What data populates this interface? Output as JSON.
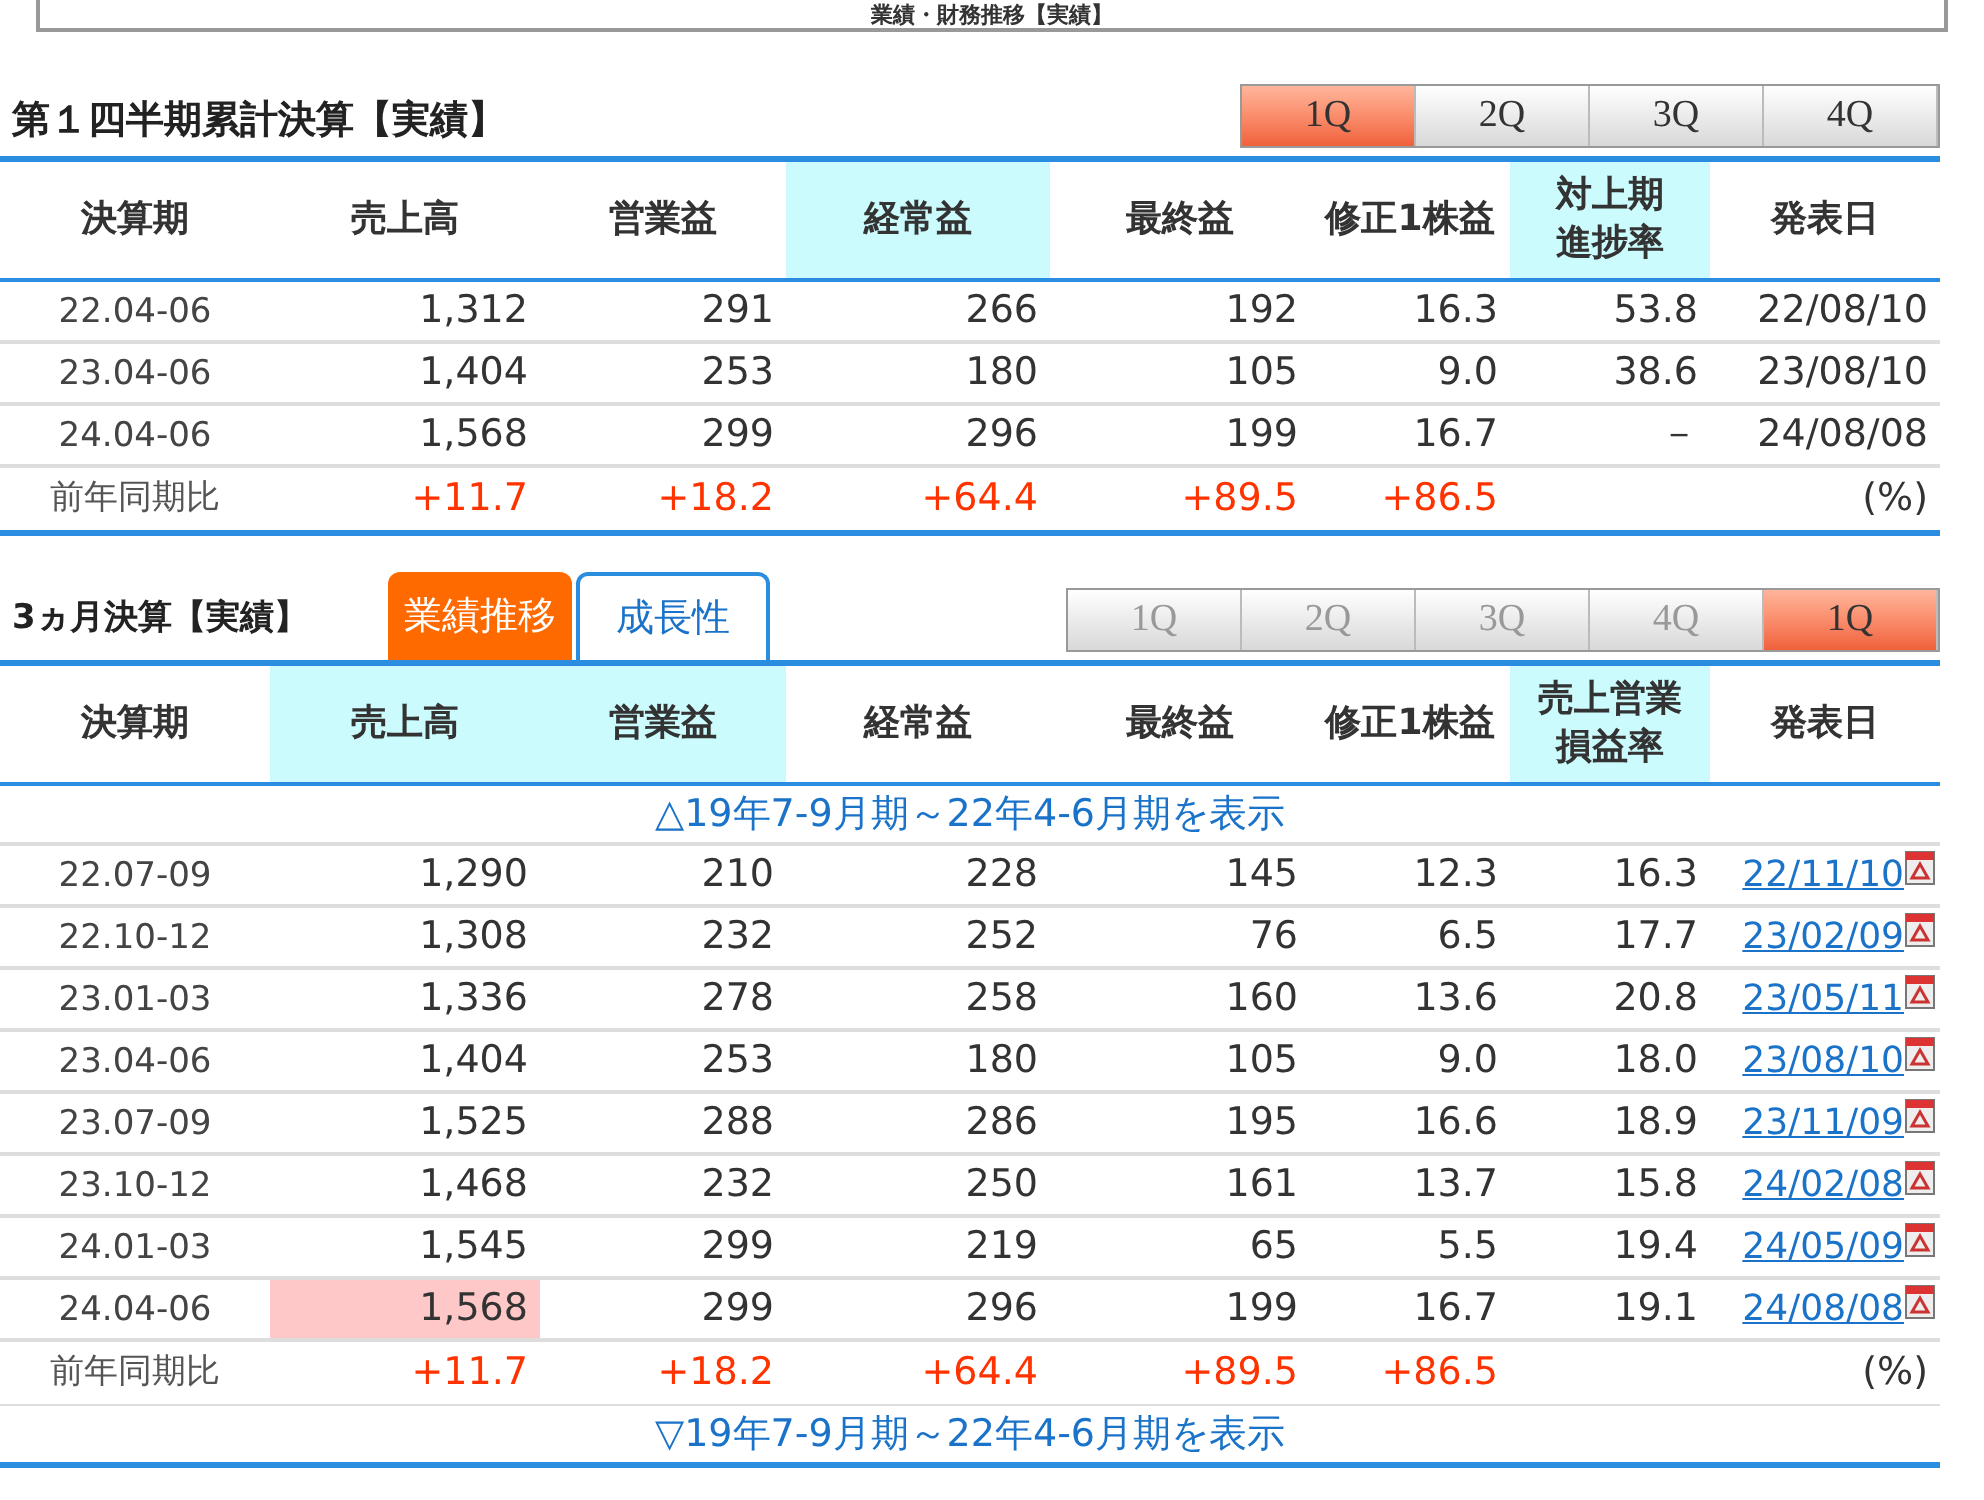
{
  "top_panel": {
    "title": "業績・財務推移【実績】"
  },
  "sections": [
    {
      "title": "第１四半期累計決算【実績】",
      "quarter_buttons": [
        {
          "label": "1Q",
          "selected": true,
          "disabled": false
        },
        {
          "label": "2Q",
          "selected": false,
          "disabled": false
        },
        {
          "label": "3Q",
          "selected": false,
          "disabled": false
        },
        {
          "label": "4Q",
          "selected": false,
          "disabled": false
        }
      ],
      "columns": [
        {
          "label": "決算期",
          "highlighted": false,
          "kind": "text"
        },
        {
          "label": "売上高",
          "highlighted": false,
          "kind": "number"
        },
        {
          "label": "営業益",
          "highlighted": false,
          "kind": "number"
        },
        {
          "label": "経常益",
          "highlighted": true,
          "kind": "number"
        },
        {
          "label": "最終益",
          "highlighted": false,
          "kind": "number"
        },
        {
          "label": "修正1株益",
          "highlighted": false,
          "kind": "number"
        },
        {
          "label": "対上期進捗率",
          "highlighted": true,
          "kind": "number"
        },
        {
          "label": "発表日",
          "highlighted": false,
          "kind": "number"
        }
      ],
      "rows": [
        {
          "kind": "data",
          "cells": [
            "22.04-06",
            "1,312",
            "291",
            "266",
            "192",
            "16.3",
            "53.8",
            "22/08/10"
          ]
        },
        {
          "kind": "data",
          "cells": [
            "23.04-06",
            "1,404",
            "253",
            "180",
            "105",
            "9.0",
            "38.6",
            "23/08/10"
          ]
        },
        {
          "kind": "data",
          "cells": [
            "24.04-06",
            "1,568",
            "299",
            "296",
            "199",
            "16.7",
            "－",
            "24/08/08"
          ]
        },
        {
          "kind": "yoy",
          "cells": [
            "前年同期比",
            "+11.7",
            "+18.2",
            "+64.4",
            "+89.5",
            "+86.5",
            null,
            "(%)"
          ]
        }
      ]
    },
    {
      "title": "3ヵ月決算【実績】",
      "tabs": [
        {
          "label": "業績推移",
          "selected": true
        },
        {
          "label": "成長性",
          "selected": false
        }
      ],
      "quarter_buttons": [
        {
          "label": "1Q",
          "selected": false,
          "disabled": true
        },
        {
          "label": "2Q",
          "selected": false,
          "disabled": true
        },
        {
          "label": "3Q",
          "selected": false,
          "disabled": true
        },
        {
          "label": "4Q",
          "selected": false,
          "disabled": true
        },
        {
          "label": "1Q",
          "selected": true,
          "disabled": false
        }
      ],
      "columns": [
        {
          "label": "決算期",
          "highlighted": false,
          "kind": "text"
        },
        {
          "label": "売上高",
          "highlighted": true,
          "kind": "number"
        },
        {
          "label": "営業益",
          "highlighted": true,
          "kind": "number"
        },
        {
          "label": "経常益",
          "highlighted": false,
          "kind": "number"
        },
        {
          "label": "最終益",
          "highlighted": false,
          "kind": "number"
        },
        {
          "label": "修正1株益",
          "highlighted": false,
          "kind": "number"
        },
        {
          "label": "売上営業損益率",
          "highlighted": true,
          "kind": "number"
        },
        {
          "label": "発表日",
          "highlighted": false,
          "kind": "link"
        }
      ],
      "top_toggle": "△19年7-9月期～22年4-6月期を表示",
      "rows": [
        {
          "kind": "data",
          "cells": [
            "22.07-09",
            "1,290",
            "210",
            "228",
            "145",
            "12.3",
            "16.3",
            "22/11/10"
          ]
        },
        {
          "kind": "data",
          "cells": [
            "22.10-12",
            "1,308",
            "232",
            "252",
            "76",
            "6.5",
            "17.7",
            "23/02/09"
          ]
        },
        {
          "kind": "data",
          "cells": [
            "23.01-03",
            "1,336",
            "278",
            "258",
            "160",
            "13.6",
            "20.8",
            "23/05/11"
          ]
        },
        {
          "kind": "data",
          "cells": [
            "23.04-06",
            "1,404",
            "253",
            "180",
            "105",
            "9.0",
            "18.0",
            "23/08/10"
          ]
        },
        {
          "kind": "data",
          "cells": [
            "23.07-09",
            "1,525",
            "288",
            "286",
            "195",
            "16.6",
            "18.9",
            "23/11/09"
          ]
        },
        {
          "kind": "data",
          "cells": [
            "23.10-12",
            "1,468",
            "232",
            "250",
            "161",
            "13.7",
            "15.8",
            "24/02/08"
          ]
        },
        {
          "kind": "data",
          "cells": [
            "24.01-03",
            "1,545",
            "299",
            "219",
            "65",
            "5.5",
            "19.4",
            "24/05/09"
          ]
        },
        {
          "kind": "data",
          "cells": [
            "24.04-06",
            {
              "value": "1,568",
              "highlighted": true
            },
            "299",
            "296",
            "199",
            "16.7",
            "19.1",
            "24/08/08"
          ]
        },
        {
          "kind": "yoy",
          "cells": [
            "前年同期比",
            "+11.7",
            "+18.2",
            "+64.4",
            "+89.5",
            "+86.5",
            null,
            "(%)"
          ]
        }
      ],
      "bottom_toggle": "▽19年7-9月期～22年4-6月期を表示"
    }
  ]
}
